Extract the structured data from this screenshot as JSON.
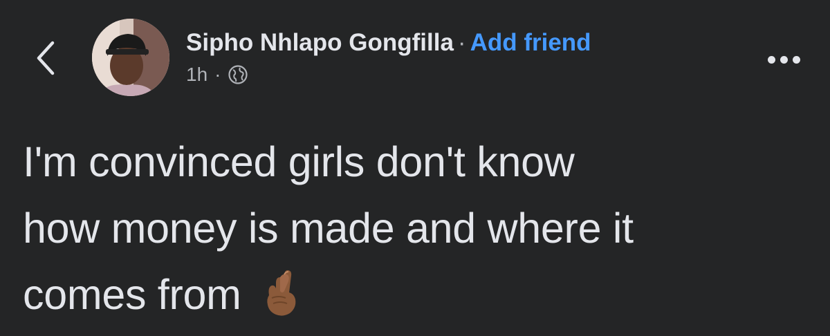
{
  "header": {
    "back_icon": "chevron-left-icon",
    "author_name": "Sipho Nhlapo Gongfilla",
    "separator": "·",
    "add_friend_label": "Add friend",
    "timestamp": "1h",
    "meta_separator": "·",
    "privacy_icon": "globe-icon",
    "more_icon": "more-horizontal-icon"
  },
  "post": {
    "lines": [
      "I'm convinced girls don't know",
      "how money is made and where it",
      "comes from"
    ],
    "emoji_icon": "crossed-fingers-medium-dark-skin-tone"
  },
  "colors": {
    "background": "#242526",
    "text": "#e4e6eb",
    "secondary_text": "#b0b3b8",
    "link": "#4599ff"
  }
}
